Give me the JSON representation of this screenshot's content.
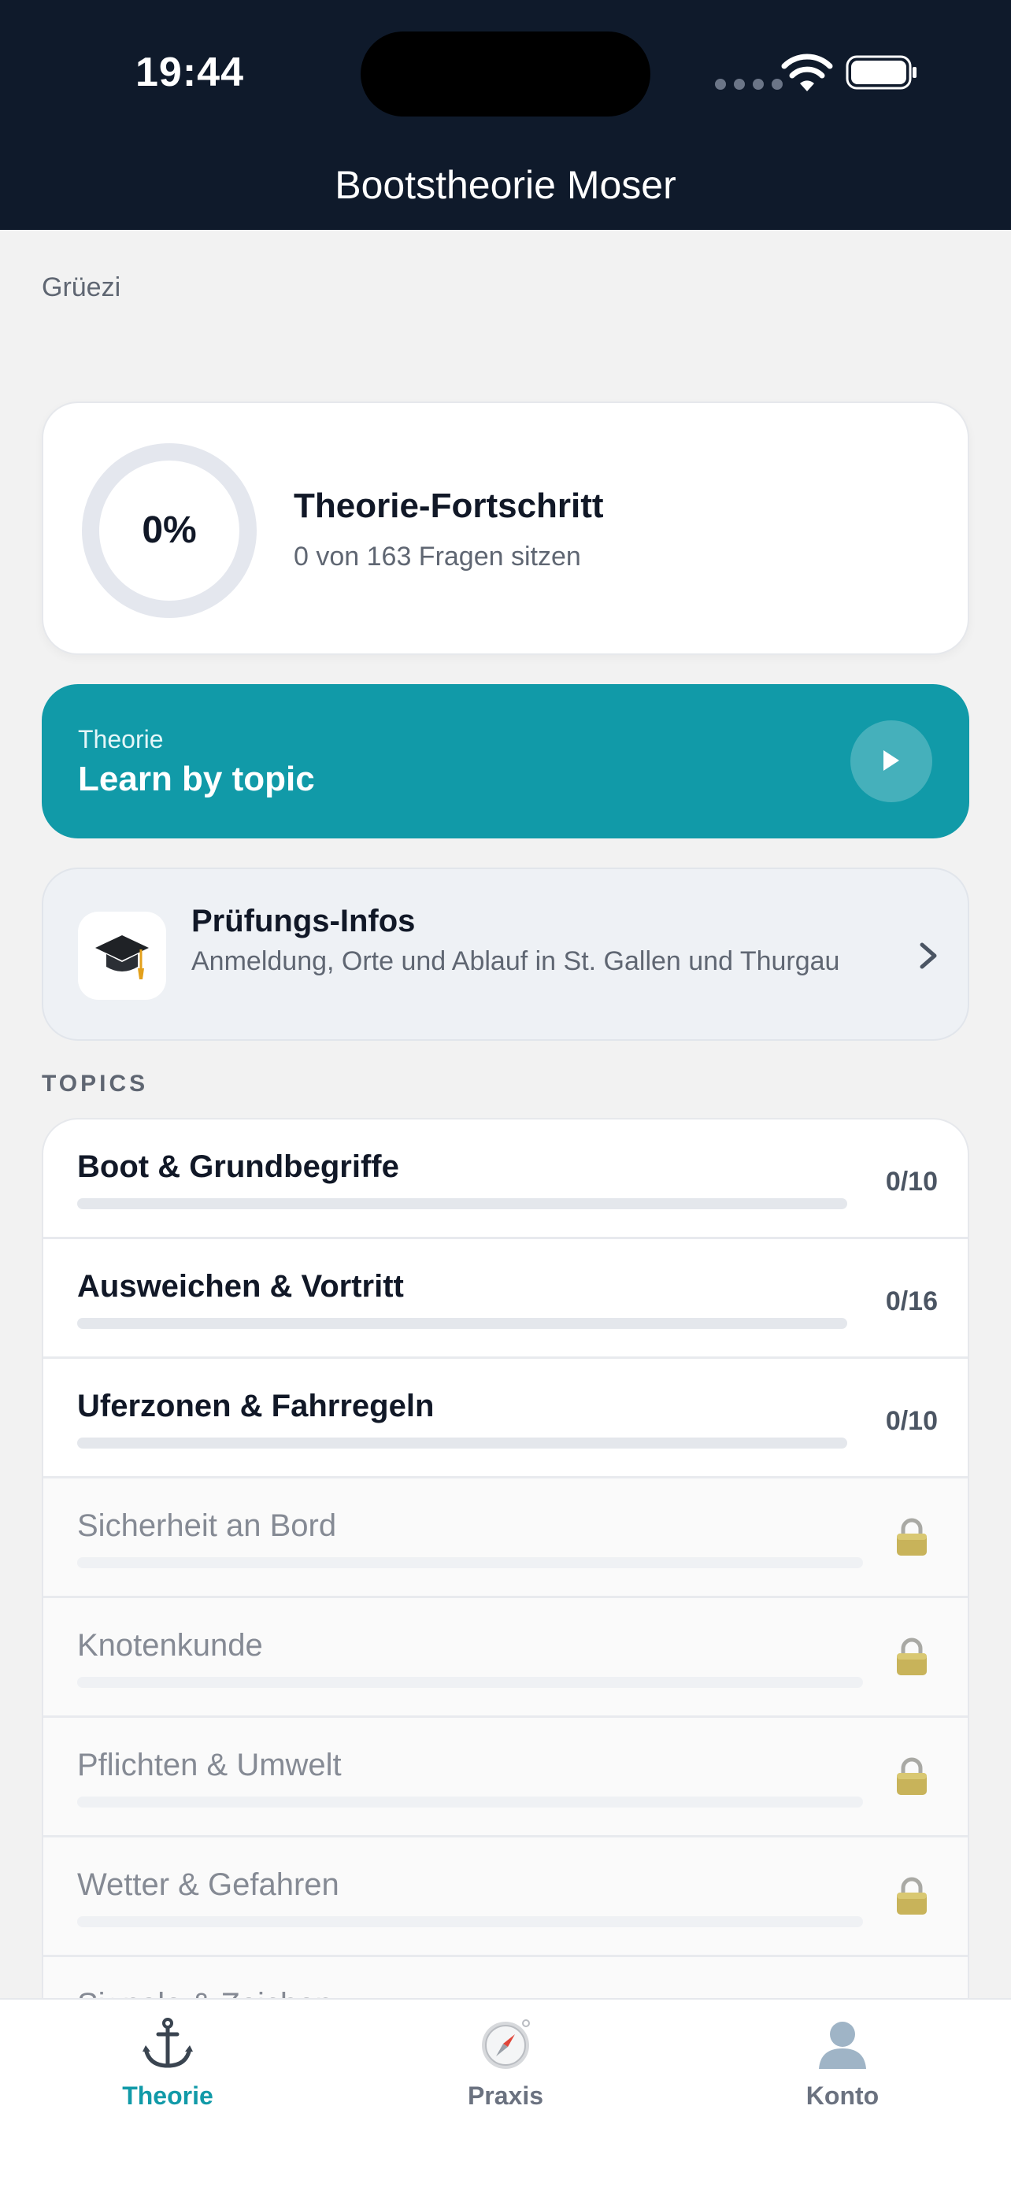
{
  "status_bar": {
    "time": "19:44"
  },
  "header": {
    "title": "Bootstheorie Moser"
  },
  "greeting": "Grüezi",
  "progress": {
    "percent_label": "0%",
    "percent_value": 0,
    "title": "Theorie-Fortschritt",
    "subtitle": "0 von 163 Fragen sitzen"
  },
  "learn": {
    "kicker": "Theorie",
    "title": "Learn by topic",
    "icon": "play-icon"
  },
  "exam_info": {
    "title": "Prüfungs-Infos",
    "description": "Anmeldung, Orte und Ablauf in St. Gallen und Thurgau",
    "icon": "graduation-cap-icon"
  },
  "topics_label": "TOPICS",
  "topics": [
    {
      "name": "Boot & Grundbegriffe",
      "count": "0/10",
      "locked": false,
      "progress": 0
    },
    {
      "name": "Ausweichen & Vortritt",
      "count": "0/16",
      "locked": false,
      "progress": 0
    },
    {
      "name": "Uferzonen & Fahrregeln",
      "count": "0/10",
      "locked": false,
      "progress": 0
    },
    {
      "name": "Sicherheit an Bord",
      "count": "",
      "locked": true,
      "progress": 0
    },
    {
      "name": "Knotenkunde",
      "count": "",
      "locked": true,
      "progress": 0
    },
    {
      "name": "Pflichten & Umwelt",
      "count": "",
      "locked": true,
      "progress": 0
    },
    {
      "name": "Wetter & Gefahren",
      "count": "",
      "locked": true,
      "progress": 0
    },
    {
      "name": "Signale & Zeichen",
      "count": "",
      "locked": true,
      "progress": 0
    }
  ],
  "tabs": [
    {
      "label": "Theorie",
      "icon": "anchor-icon",
      "active": true
    },
    {
      "label": "Praxis",
      "icon": "compass-icon",
      "active": false
    },
    {
      "label": "Konto",
      "icon": "person-icon",
      "active": false
    }
  ],
  "colors": {
    "header_bg": "#0f1a2b",
    "accent": "#119aa8",
    "background": "#f2f2f2"
  }
}
